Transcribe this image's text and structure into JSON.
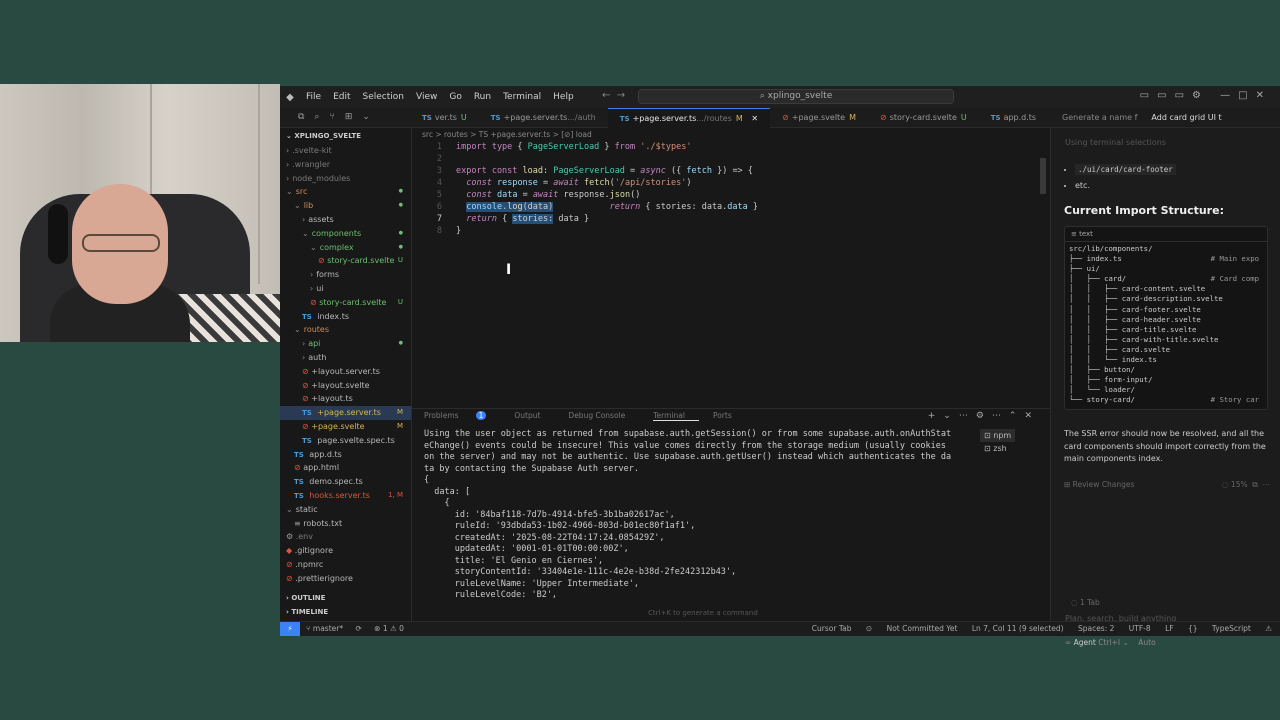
{
  "window": {
    "search": "xplingo_svelte",
    "menu": [
      "File",
      "Edit",
      "Selection",
      "View",
      "Go",
      "Run",
      "Terminal",
      "Help"
    ]
  },
  "tabs": [
    {
      "label": "ver.ts",
      "kind": "ts",
      "suffix": "U"
    },
    {
      "label": "+page.server.ts",
      "kind": "ts",
      "dim": ".../auth"
    },
    {
      "label": "+page.server.ts",
      "kind": "ts",
      "dim": ".../routes",
      "suffix": "M",
      "active": true
    },
    {
      "label": "+page.svelte",
      "kind": "sv",
      "suffix": "M"
    },
    {
      "label": "story-card.svelte",
      "kind": "sv",
      "suffix": "U"
    },
    {
      "label": "app.d.ts",
      "kind": "ts"
    }
  ],
  "chat_tabs": [
    "Generate a name f",
    "Add card grid UI t"
  ],
  "explorer": {
    "title": "XPLINGO_SVELTE",
    "items": [
      {
        "label": ".svelte-kit",
        "chev": "›",
        "indent": 0,
        "color": "gray"
      },
      {
        "label": ".wrangler",
        "chev": "›",
        "indent": 0,
        "color": "gray"
      },
      {
        "label": "node_modules",
        "chev": "›",
        "indent": 0,
        "color": "gray"
      },
      {
        "label": "src",
        "chev": "⌄",
        "indent": 0,
        "color": "orange",
        "dot": true
      },
      {
        "label": "lib",
        "chev": "⌄",
        "indent": 1,
        "color": "orange",
        "dot": true
      },
      {
        "label": "assets",
        "chev": "›",
        "indent": 2
      },
      {
        "label": "components",
        "chev": "⌄",
        "indent": 2,
        "color": "green",
        "dot": true
      },
      {
        "label": "complex",
        "chev": "⌄",
        "indent": 3,
        "color": "green",
        "dot": true
      },
      {
        "label": "story-card.svelte",
        "indent": 4,
        "icon": "sv",
        "color": "green",
        "badge": "U"
      },
      {
        "label": "forms",
        "chev": "›",
        "indent": 3
      },
      {
        "label": "ui",
        "chev": "›",
        "indent": 3
      },
      {
        "label": "story-card.svelte",
        "indent": 3,
        "icon": "sv",
        "color": "green",
        "badge": "U"
      },
      {
        "label": "index.ts",
        "indent": 2,
        "icon": "ts"
      },
      {
        "label": "routes",
        "chev": "⌄",
        "indent": 1,
        "color": "orange"
      },
      {
        "label": "api",
        "chev": "›",
        "indent": 2,
        "color": "green",
        "dot": true
      },
      {
        "label": "auth",
        "chev": "›",
        "indent": 2
      },
      {
        "label": "+layout.server.ts",
        "indent": 2,
        "icon": "sv"
      },
      {
        "label": "+layout.svelte",
        "indent": 2,
        "icon": "sv"
      },
      {
        "label": "+layout.ts",
        "indent": 2,
        "icon": "sv"
      },
      {
        "label": "+page.server.ts",
        "indent": 2,
        "icon": "ts",
        "color": "yellow",
        "badge": "M",
        "selected": true
      },
      {
        "label": "+page.svelte",
        "indent": 2,
        "icon": "sv",
        "color": "yellow",
        "badge": "M"
      },
      {
        "label": "page.svelte.spec.ts",
        "indent": 2,
        "icon": "ts"
      },
      {
        "label": "app.d.ts",
        "indent": 1,
        "icon": "ts"
      },
      {
        "label": "app.html",
        "indent": 1,
        "icon": "sv"
      },
      {
        "label": "demo.spec.ts",
        "indent": 1,
        "icon": "ts"
      },
      {
        "label": "hooks.server.ts",
        "indent": 1,
        "icon": "ts",
        "color": "red",
        "badge": "1, M"
      },
      {
        "label": "static",
        "chev": "⌄",
        "indent": 0
      },
      {
        "label": "robots.txt",
        "indent": 1,
        "icon": "txt"
      },
      {
        "label": ".env",
        "indent": 0,
        "icon": "gear",
        "color": "gray"
      },
      {
        "label": ".gitignore",
        "indent": 0,
        "icon": "git"
      },
      {
        "label": ".npmrc",
        "indent": 0,
        "icon": "sv"
      },
      {
        "label": ".prettierignore",
        "indent": 0,
        "icon": "sv"
      }
    ],
    "outline": "OUTLINE",
    "timeline": "TIMELINE"
  },
  "editor": {
    "breadcrumb": "src > routes > TS +page.server.ts > [⊘] load",
    "current_line": 7
  },
  "panel": {
    "tabs": [
      "Problems",
      "Output",
      "Debug Console",
      "Terminal",
      "Ports"
    ],
    "problems_count": "1",
    "terminals": [
      "npm",
      "zsh"
    ],
    "hint": "Ctrl+K to generate a command",
    "lines": [
      "Using the user object as returned from supabase.auth.getSession() or from some supabase.auth.onAuthStat",
      "eChange() events could be insecure! This value comes directly from the storage medium (usually cookies",
      "on the server) and may not be authentic. Use supabase.auth.getUser() instead which authenticates the da",
      "ta by contacting the Supabase Auth server.",
      "{",
      "  data: [",
      "    {",
      "      id: '84baf118-7d7b-4914-bfe5-3b1ba02617ac',",
      "      ruleId: '93dbda53-1b02-4966-803d-b01ec80f1af1',",
      "      createdAt: '2025-08-22T04:17:24.085429Z',",
      "      updatedAt: '0001-01-01T00:00:00Z',",
      "      title: 'El Genio en Ciernes',",
      "      storyContentId: '33404e1e-111c-4e2e-b38d-2fe242312b43',",
      "      ruleLevelName: 'Upper Intermediate',",
      "      ruleLevelCode: 'B2',"
    ]
  },
  "chat": {
    "faded_top": "Using terminal selections",
    "bullets": [
      "./ui/card/card-footer",
      "etc."
    ],
    "heading": "Current Import Structure:",
    "code_label": "text",
    "code_lines": [
      "src/lib/components/",
      "├── index.ts",
      "├── ui/",
      "│   ├── card/",
      "│   │   ├── card-content.svelte",
      "│   │   ├── card-description.svelte",
      "│   │   ├── card-footer.svelte",
      "│   │   ├── card-header.svelte",
      "│   │   ├── card-title.svelte",
      "│   │   ├── card-with-title.svelte",
      "│   │   ├── card.svelte",
      "│   │   └── index.ts",
      "│   ├── button/",
      "│   ├── form-input/",
      "│   └── loader/",
      "└── story-card/"
    ],
    "code_comments": [
      {
        "line": 1,
        "text": "# Main expo"
      },
      {
        "line": 3,
        "text": "# Card comp"
      },
      {
        "line": 15,
        "text": "# Story car"
      }
    ],
    "message": "The SSR error should now be resolved, and all the card components should import correctly from the main components index.",
    "review": "Review Changes",
    "review_pct": "15%",
    "tab_count": "1 Tab",
    "plan_placeholder": "Plan, search, build anything",
    "agent_label": "Agent",
    "agent_shortcut": "Ctrl+I",
    "auto": "Auto"
  },
  "status": {
    "branch": "master*",
    "errors": "⊗ 1 ⚠ 0",
    "cursor_tab": "Cursor Tab",
    "not_committed": "Not Committed Yet",
    "position": "Ln 7, Col 11 (9 selected)",
    "spaces": "Spaces: 2",
    "encoding": "UTF-8",
    "eol": "LF",
    "language": "TypeScript"
  }
}
